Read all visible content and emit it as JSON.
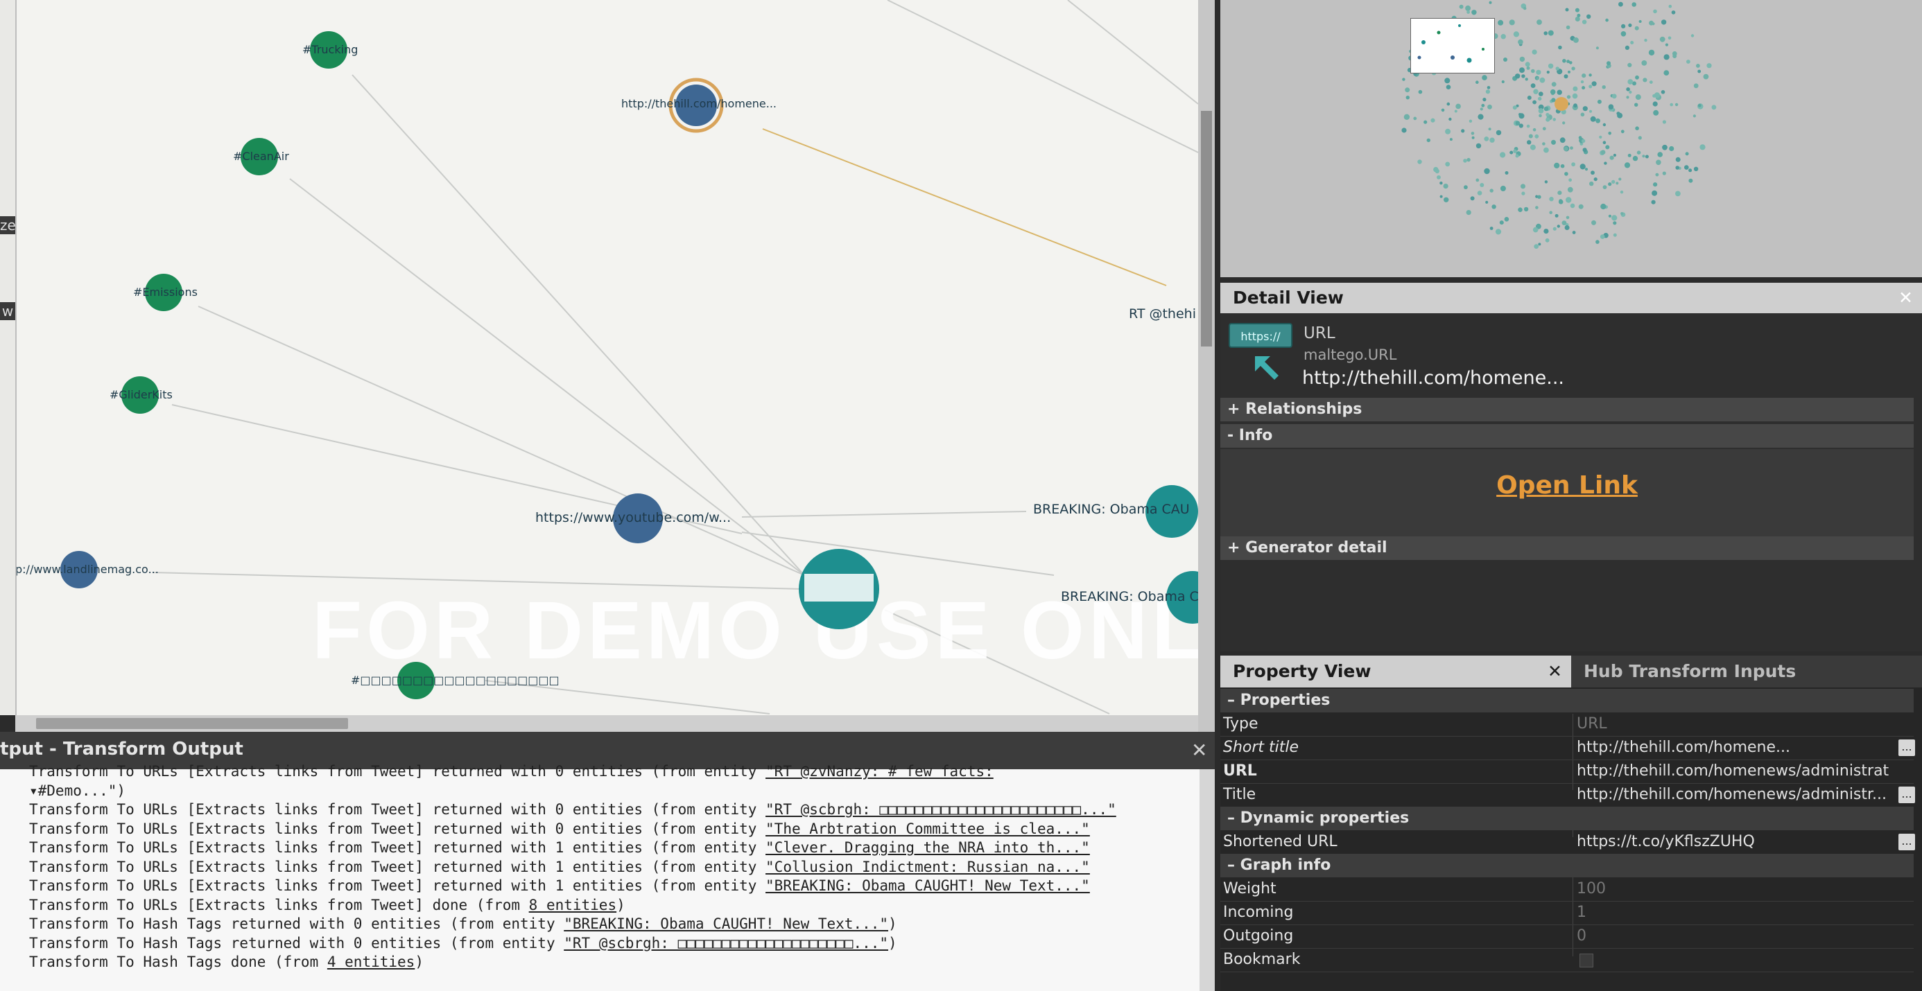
{
  "graph": {
    "watermark": "FOR DEMO USE ONLY",
    "left_tabs": [
      "ze",
      "w"
    ],
    "nodes": [
      {
        "id": "trucking",
        "label": "#Trucking"
      },
      {
        "id": "cleanair",
        "label": "#CleanAir"
      },
      {
        "id": "emissions",
        "label": "#Emissions"
      },
      {
        "id": "gliderkits",
        "label": "#GliderKits"
      },
      {
        "id": "thehill",
        "label": "http://thehill.com/homene..."
      },
      {
        "id": "rt_thehi",
        "label": "RT @thehi"
      },
      {
        "id": "youtube",
        "label": "https://www.youtube.com/w..."
      },
      {
        "id": "breaking1",
        "label": "BREAKING: Obama CAU"
      },
      {
        "id": "breaking2",
        "label": "BREAKING: Obama C"
      },
      {
        "id": "landline",
        "label": "p://www.landlinemag.co..."
      },
      {
        "id": "hash_cjk",
        "label": "#□□□□□□□□□□□□□□□□□□□"
      }
    ],
    "colors": {
      "hashtag": "#1a8a55",
      "url": "#3e6793",
      "tweet": "#1e8f8f",
      "selected_ring": "#d8a35a",
      "edge": "#c9cbc9",
      "edge_selected": "#d9b66a"
    }
  },
  "output": {
    "title": "tput - Transform Output",
    "lines": [
      {
        "pre": "Transform To URLs [Extracts links from Tweet] returned with 0 entities (from entity ",
        "ref": "\"RT @zvNanzy: # few facts:",
        "post": ""
      },
      {
        "pre": "▾#Demo...\")",
        "ref": "",
        "post": ""
      },
      {
        "pre": "Transform To URLs [Extracts links from Tweet] returned with 0 entities (from entity ",
        "ref": "\"RT @scbrgh: □□□□□□□□□□□□□□□□□□□□□□□...\"",
        "post": ""
      },
      {
        "pre": "Transform To URLs [Extracts links from Tweet] returned with 0 entities (from entity ",
        "ref": "\"The Arbtration Committee is clea...\"",
        "post": ""
      },
      {
        "pre": "Transform To URLs [Extracts links from Tweet] returned with 1 entities (from entity ",
        "ref": "\"Clever. Dragging the NRA into th...\"",
        "post": ""
      },
      {
        "pre": "Transform To URLs [Extracts links from Tweet] returned with 1 entities (from entity ",
        "ref": "\"Collusion Indictment: Russian na...\"",
        "post": ""
      },
      {
        "pre": "Transform To URLs [Extracts links from Tweet] returned with 1 entities (from entity ",
        "ref": "\"BREAKING: Obama CAUGHT! New Text...\"",
        "post": ""
      },
      {
        "pre": "Transform To URLs [Extracts links from Tweet] done (from ",
        "ref": "8 entities",
        "post": ")"
      },
      {
        "pre": "Transform To Hash Tags returned with 0 entities (from entity ",
        "ref": "\"BREAKING: Obama CAUGHT! New Text...\"",
        "post": ")"
      },
      {
        "pre": "Transform To Hash Tags returned with 0 entities (from entity ",
        "ref": "\"RT @scbrgh: □□□□□□□□□□□□□□□□□□□□...\"",
        "post": ")"
      },
      {
        "pre": "Transform To Hash Tags done (from ",
        "ref": "4 entities",
        "post": ")"
      }
    ]
  },
  "detail": {
    "title": "Detail View",
    "entity_badge": "https://",
    "entity_type": "URL",
    "entity_class": "maltego.URL",
    "entity_value": "http://thehill.com/homene...",
    "sections": {
      "relationships": "+ Relationships",
      "info": "- Info",
      "generator": "+ Generator detail"
    },
    "open_link": "Open Link"
  },
  "properties": {
    "tab_active": "Property View",
    "tab_inactive": "Hub Transform Inputs",
    "groups": {
      "properties": "– Properties",
      "dynamic": "– Dynamic properties",
      "graph": "– Graph info"
    },
    "rows": {
      "type": {
        "key": "Type",
        "value": "URL"
      },
      "short_title": {
        "key": "Short title",
        "value": "http://thehill.com/homene..."
      },
      "url": {
        "key": "URL",
        "value": "http://thehill.com/homenews/administrati..."
      },
      "title": {
        "key": "Title",
        "value": "http://thehill.com/homenews/administr..."
      },
      "shortened_url": {
        "key": "Shortened URL",
        "value": "https://t.co/yKflszZUHQ"
      },
      "weight": {
        "key": "Weight",
        "value": "100"
      },
      "incoming": {
        "key": "Incoming",
        "value": "1"
      },
      "outgoing": {
        "key": "Outgoing",
        "value": "0"
      },
      "bookmark": {
        "key": "Bookmark"
      }
    },
    "ellipsis": "..."
  }
}
